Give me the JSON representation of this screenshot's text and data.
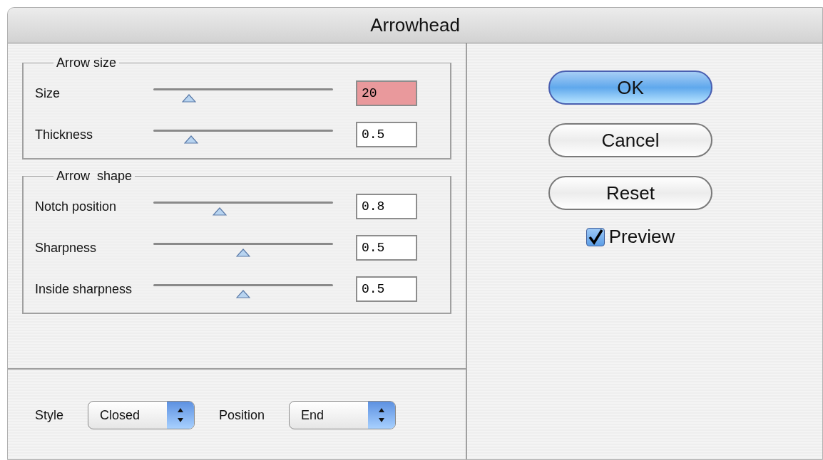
{
  "window": {
    "title": "Arrowhead"
  },
  "groups": [
    {
      "title": "Arrow size",
      "rows": [
        {
          "label": "Size",
          "level": 0.2,
          "value": "20",
          "invalid": true
        },
        {
          "label": "Thickness",
          "level": 0.21,
          "value": "0.5",
          "invalid": false
        }
      ]
    },
    {
      "title": "Arrow  shape",
      "rows": [
        {
          "label": "Notch position",
          "level": 0.37,
          "value": "0.8",
          "invalid": false
        },
        {
          "label": "Sharpness",
          "level": 0.5,
          "value": "0.5",
          "invalid": false
        },
        {
          "label": "Inside sharpness",
          "level": 0.5,
          "value": "0.5",
          "invalid": false
        }
      ]
    }
  ],
  "popups": [
    {
      "label": "Style",
      "value": "Closed"
    },
    {
      "label": "Position",
      "value": "End"
    }
  ],
  "buttons": [
    {
      "label": "OK",
      "default": true
    },
    {
      "label": "Cancel",
      "default": false
    },
    {
      "label": "Reset",
      "default": false
    }
  ],
  "preview": {
    "label": "Preview",
    "checked": true
  }
}
